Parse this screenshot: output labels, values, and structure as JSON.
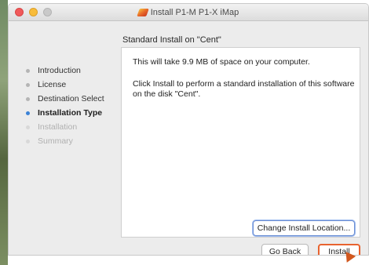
{
  "window": {
    "title": "Install P1-M P1-X iMap"
  },
  "header": {
    "title": "Standard Install on \"Cent\""
  },
  "sidebar": {
    "items": [
      {
        "label": "Introduction",
        "state": "done"
      },
      {
        "label": "License",
        "state": "done"
      },
      {
        "label": "Destination Select",
        "state": "done"
      },
      {
        "label": "Installation Type",
        "state": "active"
      },
      {
        "label": "Installation",
        "state": "pending"
      },
      {
        "label": "Summary",
        "state": "pending"
      }
    ]
  },
  "content": {
    "line1": "This will take 9.9 MB of space on your computer.",
    "line2": "Click Install to perform a standard installation of this software on the disk \"Cent\".",
    "change_location_label": "Change Install Location..."
  },
  "footer": {
    "go_back_label": "Go Back",
    "install_label": "Install"
  },
  "colors": {
    "accent_active": "#3b82d6",
    "highlight_box": "#e8632f",
    "close_light": "#f0595a",
    "minimize_light": "#f8bc3a"
  }
}
